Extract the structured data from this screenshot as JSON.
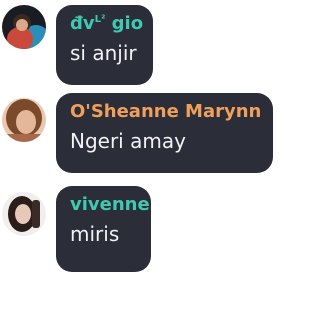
{
  "messages": [
    {
      "author": "đv",
      "author_superscript": "L²",
      "author_suffix": " gio",
      "text": "si anjir",
      "name_color": "#3fc9b0"
    },
    {
      "author": "O'Sheanne Marynn",
      "text": "Ngeri amay",
      "name_color": "#f0a05a"
    },
    {
      "author": "vivenne",
      "text": "miris",
      "name_color": "#3fc9b0"
    }
  ],
  "colors": {
    "bubble": "#2b2d38",
    "message_text": "#f2f2f5",
    "background": "#ffffff"
  }
}
